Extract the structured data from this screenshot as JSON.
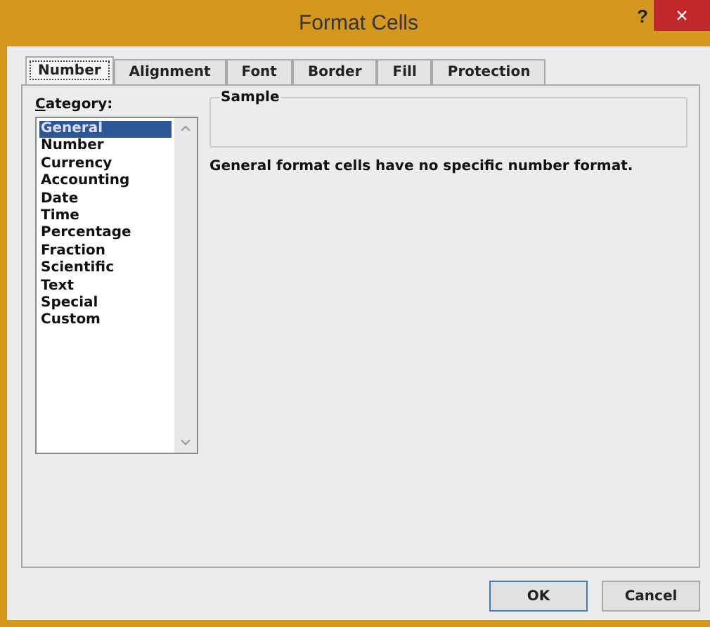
{
  "window": {
    "title": "Format Cells",
    "help": "?",
    "close": "×"
  },
  "tabs": [
    {
      "label": "Number",
      "selected": true
    },
    {
      "label": "Alignment",
      "selected": false
    },
    {
      "label": "Font",
      "selected": false
    },
    {
      "label": "Border",
      "selected": false
    },
    {
      "label": "Fill",
      "selected": false
    },
    {
      "label": "Protection",
      "selected": false
    }
  ],
  "category": {
    "label": "Category:",
    "items": [
      {
        "label": "General",
        "selected": true
      },
      {
        "label": "Number",
        "selected": false
      },
      {
        "label": "Currency",
        "selected": false
      },
      {
        "label": "Accounting",
        "selected": false
      },
      {
        "label": "Date",
        "selected": false
      },
      {
        "label": "Time",
        "selected": false
      },
      {
        "label": "Percentage",
        "selected": false
      },
      {
        "label": "Fraction",
        "selected": false
      },
      {
        "label": "Scientific",
        "selected": false
      },
      {
        "label": "Text",
        "selected": false
      },
      {
        "label": "Special",
        "selected": false
      },
      {
        "label": "Custom",
        "selected": false
      }
    ]
  },
  "sample": {
    "label": "Sample"
  },
  "description": "General format cells have no specific number format.",
  "buttons": [
    {
      "label": "OK",
      "default": true
    },
    {
      "label": "Cancel",
      "default": false
    }
  ]
}
